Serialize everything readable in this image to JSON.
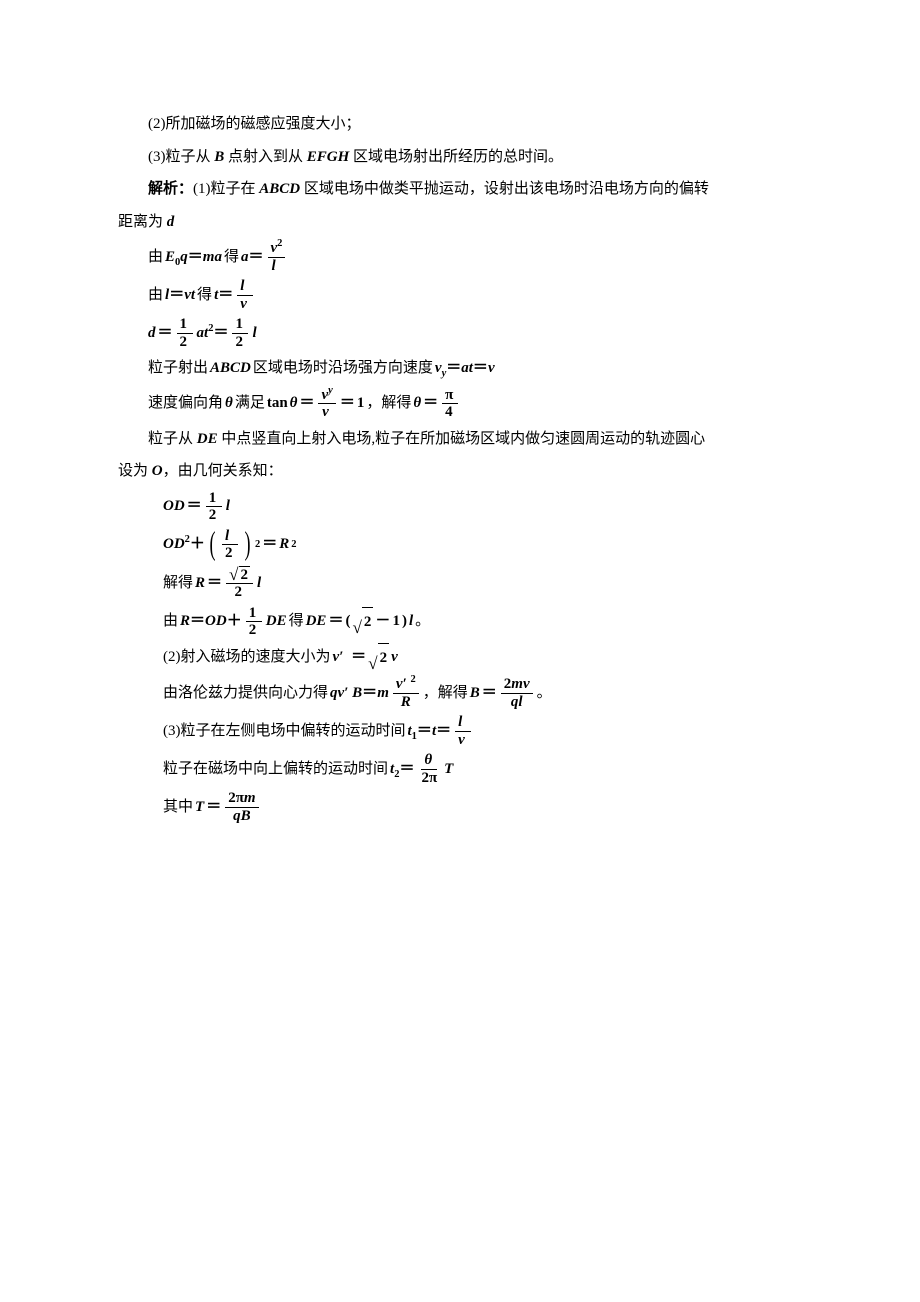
{
  "lines": {
    "q2": "(2)所加磁场的磁感应强度大小；",
    "q3_a": "(3)粒子从 ",
    "q3_b": " 点射入到从 ",
    "q3_c": " 区域电场射出所经历的总时间。",
    "s1_a": "解析：",
    "s1_b": "(1)粒子在 ",
    "s1_c": " 区域电场中做类平抛运动，设射出该电场时沿电场方向的偏转",
    "s1_cont": "距离为 ",
    "m1_a": "由 ",
    "m1_b": " 得 ",
    "m2_a": "由 ",
    "m2_b": " 得 ",
    "m4_a": "粒子射出 ",
    "m4_b": " 区域电场时沿场强方向速度 ",
    "m5_a": "速度偏向角 ",
    "m5_b": " 满足 ",
    "m5_c": "，解得 ",
    "m6_a": "粒子从 ",
    "m6_b": " 中点竖直向上射入电场,粒子在所加磁场区域内做匀速圆周运动的轨迹圆心",
    "m6_c": "设为 ",
    "m6_d": "，由几何关系知：",
    "m9_a": "解得 ",
    "m10_a": "由 ",
    "m10_b": " 得 ",
    "m10_c": "。",
    "p2_a": "(2)射入磁场的速度大小为 ",
    "p2_b": "由洛伦兹力提供向心力得 ",
    "p2_c": "，解得 ",
    "p2_d": "。",
    "p3_a": "(3)粒子在左侧电场中偏转的运动时间 ",
    "p3_b": "粒子在磁场中向上偏转的运动时间 ",
    "p3_c": "其中 "
  },
  "sym": {
    "B": "B",
    "EFGH": "EFGH",
    "ABCD": "ABCD",
    "d": "d",
    "E0": "E",
    "zero": "0",
    "q": "q",
    "eq": "＝",
    "m": "m",
    "a": "a",
    "v": "v",
    "two": "2",
    "l": "l",
    "t": "t",
    "one": "1",
    "half_at2_l": "l",
    "vy": "v",
    "y": "y",
    "at": "at",
    "theta": "θ",
    "tan": "tan ",
    "vyy": "v",
    "yy": "y",
    "pi": "π",
    "four": "4",
    "DE": "DE",
    "O": "O",
    "OD": "OD",
    "OD2": "OD",
    "plus": "＋",
    "R": "R",
    "root2": "2",
    "minus": "－",
    "lparen": "(",
    "rparen": ")",
    "vprime": "v′",
    "prime": "′",
    "sq": "2",
    "Bcap": "B",
    "twomv": "2mv",
    "ql": "ql",
    "t1": "t",
    "sub1": "1",
    "t2": "t",
    "sub2": "2",
    "twopi": "2π",
    "T": "T",
    "twopim": "2πm",
    "qB": "qB"
  }
}
